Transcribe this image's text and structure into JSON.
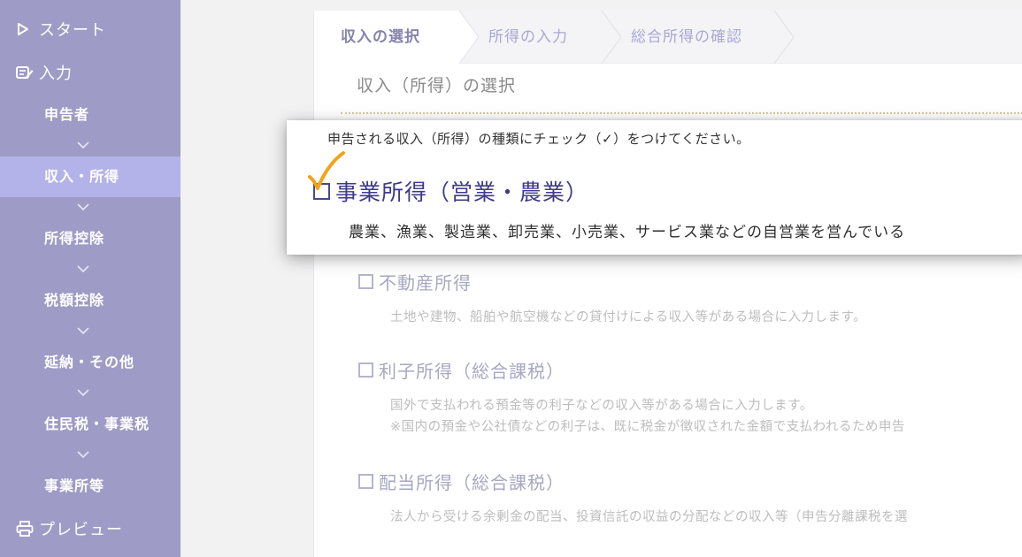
{
  "sidebar": {
    "start": {
      "label": "スタート",
      "icon": "play-outline-icon"
    },
    "input": {
      "label": "入力",
      "icon": "edit-form-icon"
    },
    "steps": [
      {
        "label": "申告者"
      },
      {
        "label": "収入・所得",
        "active": true
      },
      {
        "label": "所得控除"
      },
      {
        "label": "税額控除"
      },
      {
        "label": "延納・その他"
      },
      {
        "label": "住民税・事業税"
      },
      {
        "label": "事業所等"
      }
    ],
    "preview": {
      "label": "プレビュー",
      "icon": "printer-icon"
    }
  },
  "breadcrumb": [
    {
      "label": "収入の選択",
      "state": "current"
    },
    {
      "label": "所得の入力",
      "state": "todo"
    },
    {
      "label": "総合所得の確認",
      "state": "todo"
    }
  ],
  "section_title": "収入（所得）の選択",
  "card": {
    "instruction": "申告される収入（所得）の種類にチェック（✓）をつけてください。",
    "heading": "事業所得（営業・農業）",
    "description": "農業、漁業、製造業、卸売業、小売業、サービス業などの自営業を営んでいる",
    "checked": true
  },
  "incomes": [
    {
      "label": "不動産所得",
      "lines": [
        "土地や建物、船舶や航空機などの貸付けによる収入等がある場合に入力します。"
      ]
    },
    {
      "label": "利子所得（総合課税）",
      "lines": [
        "国外で支払われる預金等の利子などの収入等がある場合に入力します。",
        "※国内の預金や公社債などの利子は、既に税金が徴収された金額で支払われるため申告"
      ]
    },
    {
      "label": "配当所得（総合課税）",
      "lines": [
        "法人から受ける余剰金の配当、投資信託の収益の分配などの収入等（申告分離課税を選"
      ]
    }
  ],
  "colors": {
    "sidebar_bg": "#9e9cc6",
    "sidebar_active": "#b3b2e9",
    "accent": "#3f3a8a",
    "check_mark": "#f2a31b"
  }
}
